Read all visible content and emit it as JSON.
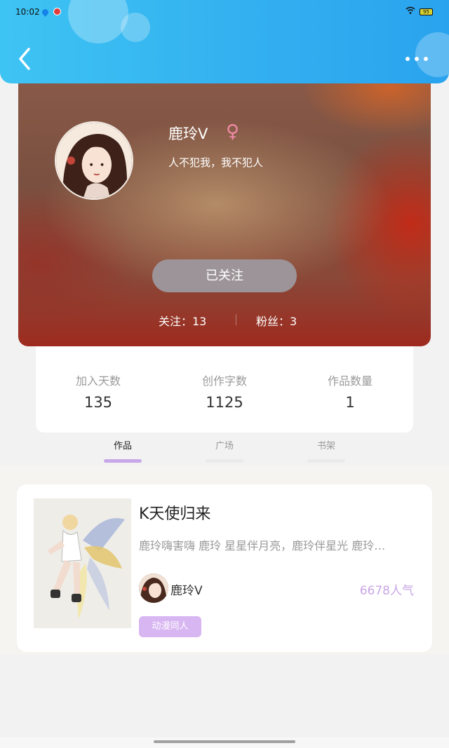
{
  "status_bar": {
    "time": "10:02",
    "battery": "95"
  },
  "header": {
    "back_icon": "chevron-left-icon",
    "more_icon": "more-horizontal-icon",
    "gradient_start": "#3ec4f3",
    "gradient_end": "#2aa3ee"
  },
  "profile": {
    "name": "鹿玲V",
    "gender_symbol": "♀",
    "bio": "人不犯我，我不犯人",
    "follow_button_label": "已关注",
    "follow_count": "关注：13",
    "fans_count": "粉丝：3"
  },
  "metrics": [
    {
      "label": "加入天数",
      "value": "135"
    },
    {
      "label": "创作字数",
      "value": "1125"
    },
    {
      "label": "作品数量",
      "value": "1"
    }
  ],
  "tabs": [
    {
      "label": "作品",
      "active": true
    },
    {
      "label": "广场",
      "active": false
    },
    {
      "label": "书架",
      "active": false
    }
  ],
  "book": {
    "title": "K天使归来",
    "description": "鹿玲嗨害嗨 鹿玲 星星伴月亮，鹿玲伴星光 鹿玲…",
    "author": "鹿玲V",
    "popularity": "6678人气",
    "tag": "动漫同人"
  },
  "colors": {
    "accent_purple": "#c9a6e6",
    "tag_bg": "#d8b6f2",
    "gender_pink": "#f08aa6"
  }
}
